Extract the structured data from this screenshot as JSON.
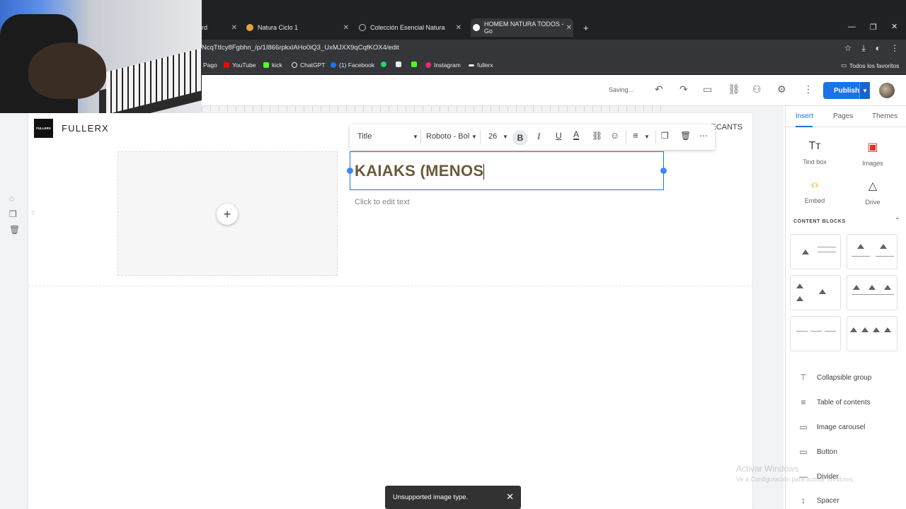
{
  "browser": {
    "tabs": [
      {
        "title": "rd",
        "favicon_color": "#9aa0a6"
      },
      {
        "title": "Natura Ciclo 1",
        "favicon_color": "#e8a33d"
      },
      {
        "title": "Colección Esencial Natura",
        "favicon_color": "#bdc1c6"
      },
      {
        "title": "HOMEM NATURA TODOS - Go",
        "favicon_color": "#ffffff"
      }
    ],
    "new_tab": "+",
    "url": "NcqTtIcy8Fgbhn_/p/1I866rpkxlAHo0iQ3_UxMJXX9qCqfKOX4/edit",
    "bookmarks": [
      {
        "label": "Pago",
        "color": "#9aa0a6"
      },
      {
        "label": "YouTube",
        "color": "#ff0000"
      },
      {
        "label": "kick",
        "color": "#53fc18"
      },
      {
        "label": "ChatGPT",
        "color": "#e8eaed"
      },
      {
        "label": "(1) Facebook",
        "color": "#1877f2"
      },
      {
        "label": "",
        "color": "#25d366"
      },
      {
        "label": "",
        "color": "#e8eaed"
      },
      {
        "label": "",
        "color": "#53fc18"
      },
      {
        "label": "Instagram",
        "color": "#e1306c"
      },
      {
        "label": "fullerx",
        "color": "#e8eaed"
      }
    ],
    "favorites": "Todos los favoritos"
  },
  "editor": {
    "status": "Saving...",
    "publish_label": "Publish",
    "accent": "#1a73e8"
  },
  "site": {
    "logo_text": "FULLERX",
    "brand": "FULLERX",
    "nav_partial": "ECANTS",
    "add_symbol": "+",
    "title_text": "KAIAKS (MENOS",
    "subtext": "Click to edit text"
  },
  "format_toolbar": {
    "style": "Title",
    "font": "Roboto - Bol",
    "size": "26"
  },
  "panel": {
    "tabs": [
      "Insert",
      "Pages",
      "Themes"
    ],
    "tiles": [
      {
        "icon": "Tт",
        "label": "Text box"
      },
      {
        "icon": "▣",
        "label": "Images"
      },
      {
        "icon": "‹›",
        "label": "Embed"
      },
      {
        "icon": "△",
        "label": "Drive"
      }
    ],
    "content_blocks_label": "CONTENT BLOCKS",
    "items": [
      {
        "icon": "⊤",
        "label": "Collapsible group"
      },
      {
        "icon": "≡",
        "label": "Table of contents"
      },
      {
        "icon": "▭",
        "label": "Image carousel"
      },
      {
        "icon": "▭",
        "label": "Button"
      },
      {
        "icon": "—",
        "label": "Divider"
      },
      {
        "icon": "↕",
        "label": "Spacer"
      }
    ]
  },
  "watermark": {
    "line1": "Activar Windows",
    "line2": "Ve a Configuración para activar Windows."
  },
  "snackbar": {
    "message": "Unsupported image type.",
    "close": "✕"
  }
}
